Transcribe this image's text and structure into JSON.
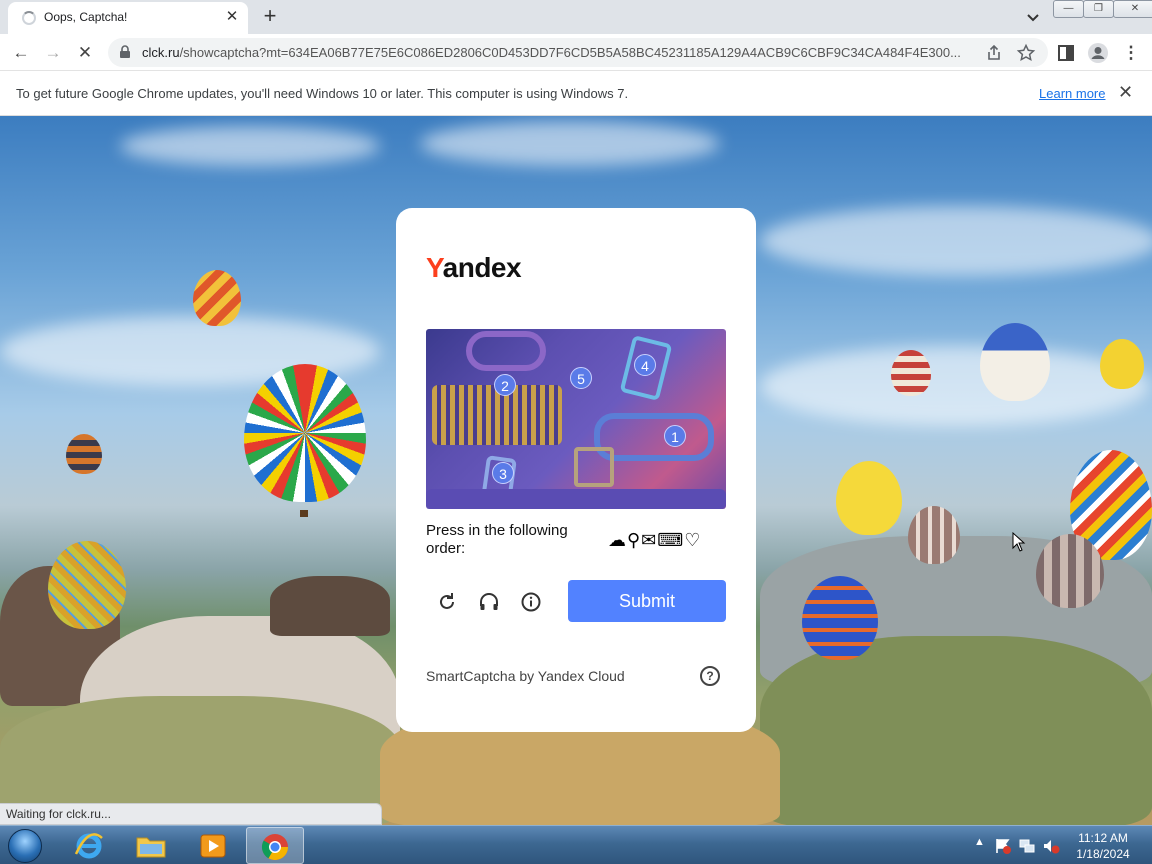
{
  "browser": {
    "tab_title": "Oops, Captcha!",
    "url_host": "clck.ru",
    "url_path": "/showcaptcha?mt=634EA06B77E75E6C086ED2806C0D453DD7F6CD5B5A58BC45231185A129A4ACB9C6CBF9C34CA484F4E300...",
    "window_controls": {
      "minimize": "—",
      "restore": "❐",
      "close": "✕"
    }
  },
  "infobar": {
    "message": "To get future Google Chrome updates, you'll need Windows 10 or later. This computer is using Windows 7.",
    "learn_more": "Learn more"
  },
  "captcha": {
    "logo_y": "Y",
    "logo_rest": "andex",
    "markers": [
      "1",
      "2",
      "3",
      "4",
      "5"
    ],
    "prompt": "Press in the following order:",
    "sequence_icons": [
      "cloud-icon",
      "trophy-icon",
      "envelope-icon",
      "keyboard-icon",
      "lightbulb-icon"
    ],
    "sequence_glyphs": "☁⚲✉⌨♡",
    "submit_label": "Submit",
    "footer": "SmartCaptcha by Yandex Cloud",
    "help_glyph": "?"
  },
  "status_bar": "Waiting for clck.ru...",
  "taskbar": {
    "time": "11:12 AM",
    "date": "1/18/2024",
    "apps": [
      "internet-explorer",
      "file-explorer",
      "media-player",
      "chrome"
    ]
  },
  "colors": {
    "accent": "#5282ff",
    "yandex_red": "#fc3f1d",
    "link": "#1a73e8"
  }
}
